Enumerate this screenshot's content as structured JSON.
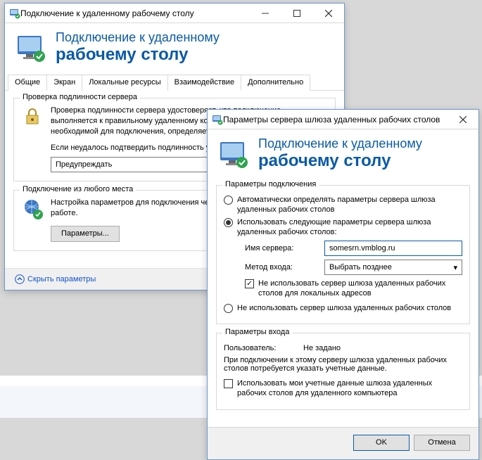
{
  "win1": {
    "title": "Подключение к удаленному рабочему столу",
    "banner": {
      "line1": "Подключение к удаленному",
      "line2": "рабочему столу"
    },
    "tabs": [
      "Общие",
      "Экран",
      "Локальные ресурсы",
      "Взаимодействие",
      "Дополнительно"
    ],
    "activeTab": 4,
    "groupAuth": {
      "legend": "Проверка подлинности сервера",
      "p1": "Проверка подлинности сервера удостоверяет, что подключение выполняется к правильному удаленному компьютеру. Строгость проверки, необходимой для подключения, определяется политикой безопасности.",
      "p2": "Если неудалось подтвердить подлинность удаленного компьютера:",
      "selectValue": "Предупреждать"
    },
    "groupAnywhere": {
      "legend": "Подключение из любого места",
      "p1": "Настройка параметров для подключения через шлюз при удаленной работе.",
      "btn": "Параметры..."
    },
    "hideParams": "Скрыть параметры"
  },
  "win2": {
    "title": "Параметры сервера шлюза удаленных рабочих столов",
    "banner": {
      "line1": "Подключение к удаленному",
      "line2": "рабочему столу"
    },
    "groupConn": {
      "legend": "Параметры подключения",
      "radioAuto": "Автоматически определять параметры сервера шлюза удаленных рабочих столов",
      "radioUse": "Использовать следующие параметры сервера шлюза удаленных рабочих столов:",
      "serverLabel": "Имя сервера:",
      "serverValue": "somesrn.vmblog.ru",
      "methodLabel": "Метод входа:",
      "methodValue": "Выбрать позднее",
      "chkBypass": "Не использовать сервер шлюза удаленных рабочих столов для локальных адресов",
      "radioNone": "Не использовать сервер шлюза удаленных рабочих столов"
    },
    "groupLogin": {
      "legend": "Параметры входа",
      "userLabel": "Пользователь:",
      "userValue": "Не задано",
      "p1": "При подключении к этому серверу шлюза удаленных рабочих столов потребуется указать учетные данные.",
      "chkShare": "Использовать мои учетные данные шлюза удаленных рабочих столов для удаленного компьютера"
    },
    "ok": "OK",
    "cancel": "Отмена"
  }
}
